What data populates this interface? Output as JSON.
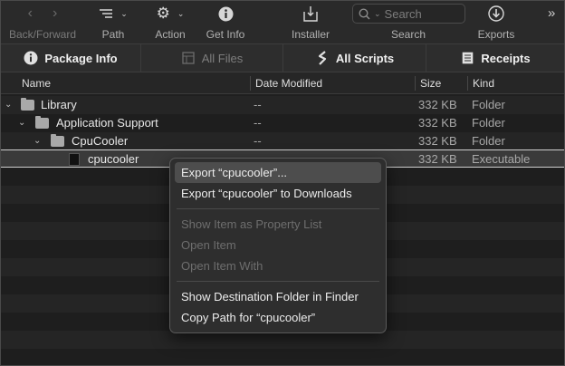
{
  "toolbar": {
    "back_forward_label": "Back/Forward",
    "path_label": "Path",
    "action_label": "Action",
    "get_info_label": "Get Info",
    "installer_label": "Installer",
    "search_label": "Search",
    "search_placeholder": "Search",
    "exports_label": "Exports"
  },
  "tabs": [
    {
      "label": "Package Info",
      "icon": "info-icon",
      "enabled": true
    },
    {
      "label": "All Files",
      "icon": "files-icon",
      "enabled": false
    },
    {
      "label": "All Scripts",
      "icon": "scripts-icon",
      "enabled": true
    },
    {
      "label": "Receipts",
      "icon": "receipts-icon",
      "enabled": true
    }
  ],
  "columns": {
    "name": "Name",
    "date_modified": "Date Modified",
    "size": "Size",
    "kind": "Kind"
  },
  "rows": [
    {
      "name": "Library",
      "date": "--",
      "size": "332 KB",
      "kind": "Folder",
      "icon": "folder-icon"
    },
    {
      "name": "Application Support",
      "date": "--",
      "size": "332 KB",
      "kind": "Folder",
      "icon": "folder-icon"
    },
    {
      "name": "CpuCooler",
      "date": "--",
      "size": "332 KB",
      "kind": "Folder",
      "icon": "folder-icon"
    },
    {
      "name": "cpucooler",
      "date": "",
      "size": "332 KB",
      "kind": "Executable",
      "icon": "executable-icon"
    }
  ],
  "context_menu": {
    "items": [
      {
        "label": "Export “cpucooler”...",
        "enabled": true,
        "highlighted": true
      },
      {
        "label": "Export “cpucooler” to Downloads",
        "enabled": true
      },
      {
        "label": "Show Item as Property List",
        "enabled": false
      },
      {
        "label": "Open Item",
        "enabled": false
      },
      {
        "label": "Open Item With",
        "enabled": false
      },
      {
        "label": "Show Destination Folder in Finder",
        "enabled": true
      },
      {
        "label": "Copy Path for “cpucooler”",
        "enabled": true
      }
    ]
  }
}
